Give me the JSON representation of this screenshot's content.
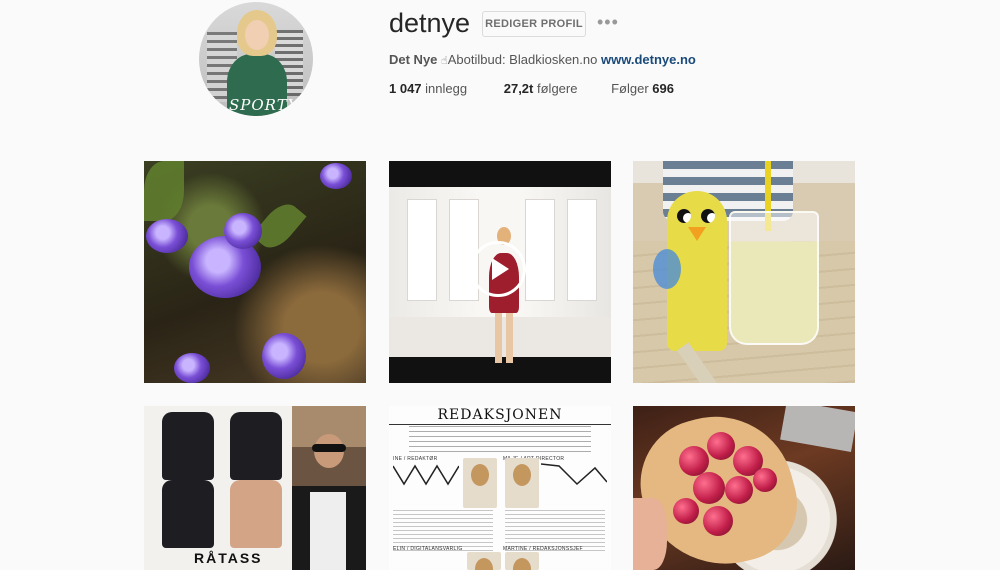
{
  "profile": {
    "username": "detnye",
    "edit_button": "REDIGER PROFIL",
    "more_icon": "•••",
    "avatar_cover_text": "SPORTY",
    "bio": {
      "full_name": "Det Nye",
      "hand_icon": "☝",
      "text": "Abotilbud: Bladkiosken.no",
      "link": "www.detnye.no"
    },
    "stats": {
      "posts_count": "1 047",
      "posts_label": "innlegg",
      "followers_count": "27,2t",
      "followers_label": "følgere",
      "following_label": "Følger",
      "following_count": "696"
    }
  },
  "grid": {
    "posts": [
      {
        "subject": "purple-flowers",
        "type": "photo"
      },
      {
        "subject": "woman-red-dress",
        "type": "video"
      },
      {
        "subject": "easter-chick-smoothie",
        "type": "photo"
      },
      {
        "subject": "leather-jackets",
        "type": "photo",
        "overlay_text": "RÅTASS"
      },
      {
        "subject": "editorial-page",
        "type": "photo",
        "overlay_text": "REDAKSJONEN",
        "roles": [
          "INE / REDAKTØR",
          "MILJE / ART DIRECTOR",
          "ELIN / DIGITALANSVARLIG",
          "MARTINE / REDAKSJONSSJEF"
        ]
      },
      {
        "subject": "raspberry-pie-coffee",
        "type": "photo"
      }
    ]
  },
  "colors": {
    "background": "#fafafa",
    "link": "#1a4a7a",
    "text": "#262626"
  }
}
